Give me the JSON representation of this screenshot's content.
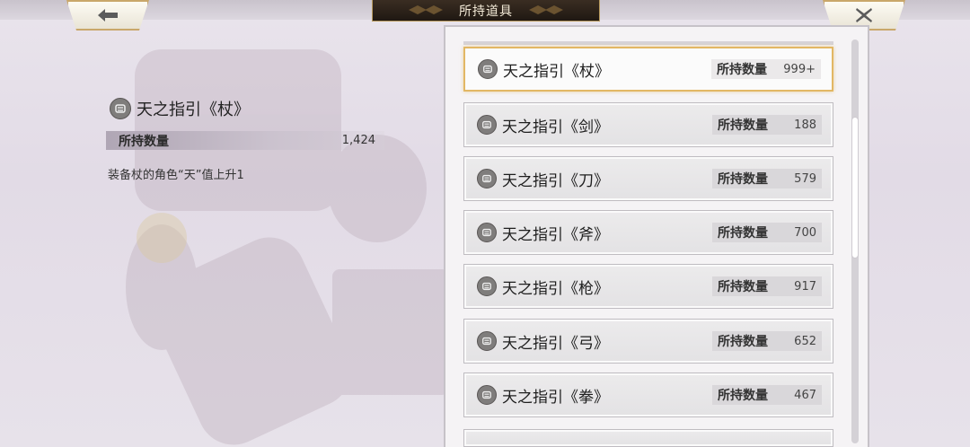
{
  "header": {
    "title": "所持道具"
  },
  "detail": {
    "name": "天之指引《杖》",
    "quantity_label": "所持数量",
    "quantity_value": "1,424",
    "description": "装备杖的角色“天”值上升1"
  },
  "items": [
    {
      "name": "天之指引《杖》",
      "qty_label": "所持数量",
      "qty": "999+",
      "selected": true
    },
    {
      "name": "天之指引《剑》",
      "qty_label": "所持数量",
      "qty": "188"
    },
    {
      "name": "天之指引《刀》",
      "qty_label": "所持数量",
      "qty": "579"
    },
    {
      "name": "天之指引《斧》",
      "qty_label": "所持数量",
      "qty": "700"
    },
    {
      "name": "天之指引《枪》",
      "qty_label": "所持数量",
      "qty": "917"
    },
    {
      "name": "天之指引《弓》",
      "qty_label": "所持数量",
      "qty": "652"
    },
    {
      "name": "天之指引《拳》",
      "qty_label": "所持数量",
      "qty": "467"
    }
  ],
  "colors": {
    "accent_border": "#e2b764",
    "title_plate": "#2a211a",
    "icon_gray": "#7f7d7c"
  },
  "icons": {
    "back": "back-arrow-icon",
    "close": "close-x-icon",
    "item": "mask-badge-icon"
  }
}
